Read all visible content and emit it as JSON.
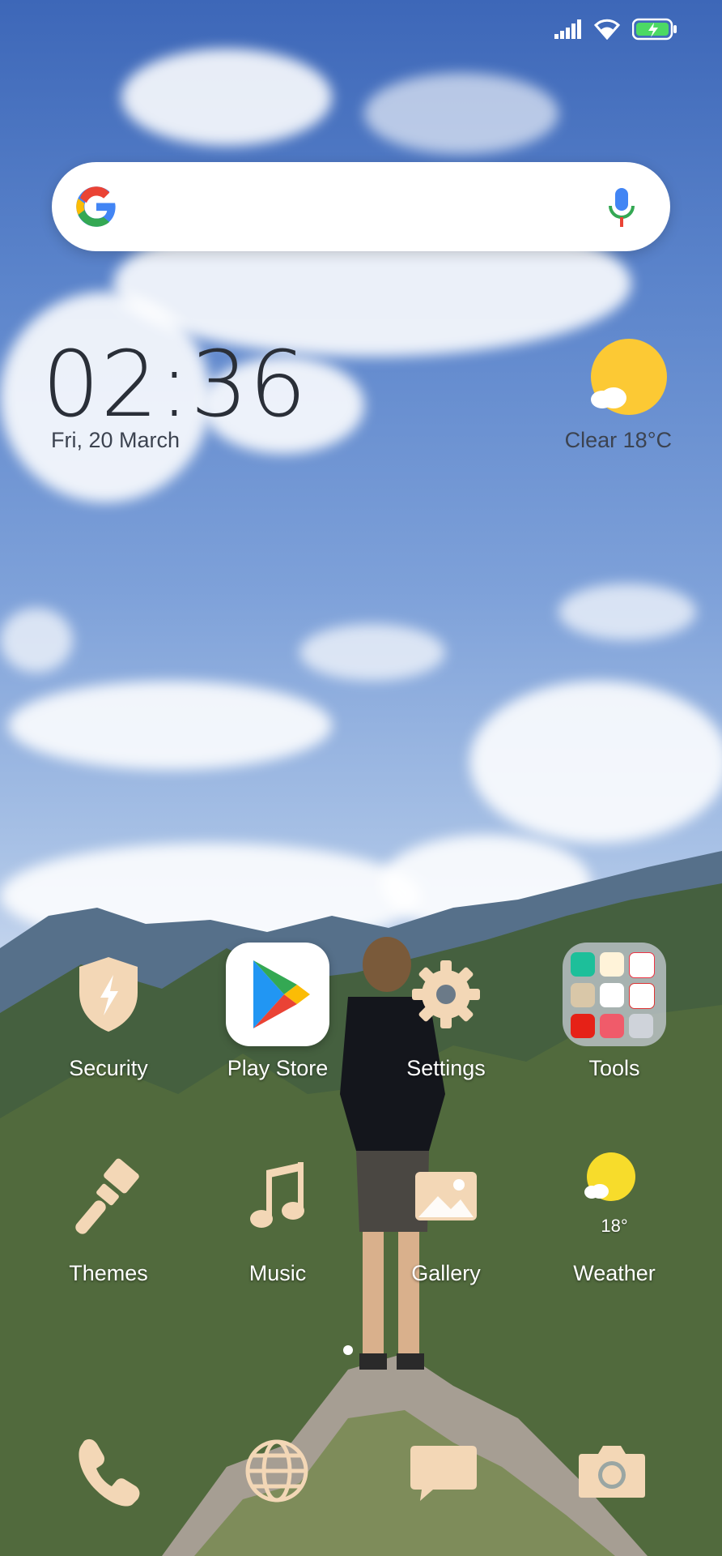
{
  "search": {
    "placeholder": ""
  },
  "clock": {
    "time": "02:36",
    "date": "Fri, 20 March"
  },
  "weather_widget": {
    "summary": "Clear  18°C",
    "color": "#fcc934"
  },
  "apps_row1": [
    {
      "label": "Security",
      "icon": "shield-bolt-icon"
    },
    {
      "label": "Play Store",
      "icon": "play-store-icon"
    },
    {
      "label": "Settings",
      "icon": "gear-icon"
    },
    {
      "label": "Tools",
      "icon": "folder-icon"
    }
  ],
  "apps_row2": [
    {
      "label": "Themes",
      "icon": "brush-icon"
    },
    {
      "label": "Music",
      "icon": "music-note-icon"
    },
    {
      "label": "Gallery",
      "icon": "image-icon"
    },
    {
      "label": "Weather",
      "icon": "weather-sun-icon",
      "temp": "18°"
    }
  ],
  "dock": [
    {
      "icon": "phone-icon"
    },
    {
      "icon": "globe-icon"
    },
    {
      "icon": "message-icon"
    },
    {
      "icon": "camera-icon"
    }
  ],
  "colors": {
    "icon_beige": "#f3d7b6",
    "label": "#ffffff",
    "accent_sun": "#fcc934"
  }
}
